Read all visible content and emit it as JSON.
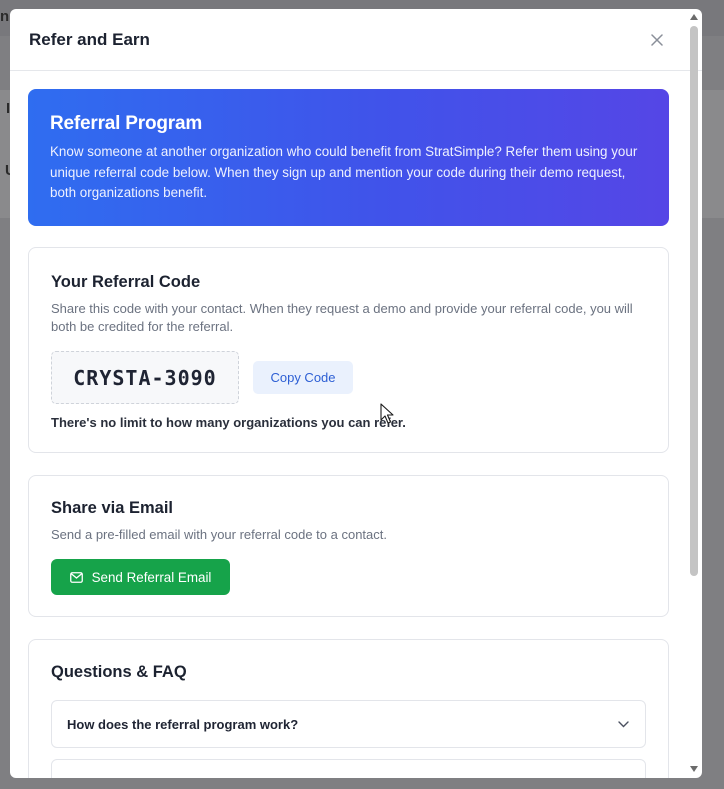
{
  "background": {
    "glyphs": [
      "n",
      "I",
      "U"
    ]
  },
  "modal": {
    "title": "Refer and Earn",
    "close_icon": "close-icon"
  },
  "hero": {
    "title": "Referral Program",
    "description": "Know someone at another organization who could benefit from StratSimple? Refer them using your unique referral code below. When they sign up and mention your code during their demo request, both organizations benefit.",
    "gradient_start": "#2f6df0",
    "gradient_end": "#5546e6"
  },
  "referral_code": {
    "heading": "Your Referral Code",
    "description": "Share this code with your contact. When they request a demo and provide your referral code, you will both be credited for the referral.",
    "code": "CRYSTA-3090",
    "copy_label": "Copy Code",
    "limit_note": "There's no limit to how many organizations you can refer."
  },
  "share_email": {
    "heading": "Share via Email",
    "description": "Send a pre-filled email with your referral code to a contact.",
    "button_label": "Send Referral Email",
    "button_icon": "mail-icon",
    "button_color": "#16a34a"
  },
  "faq": {
    "heading": "Questions & FAQ",
    "items": [
      {
        "question": "How does the referral program work?",
        "icon": "chevron-down-icon"
      },
      {
        "question": "",
        "icon": ""
      }
    ]
  }
}
